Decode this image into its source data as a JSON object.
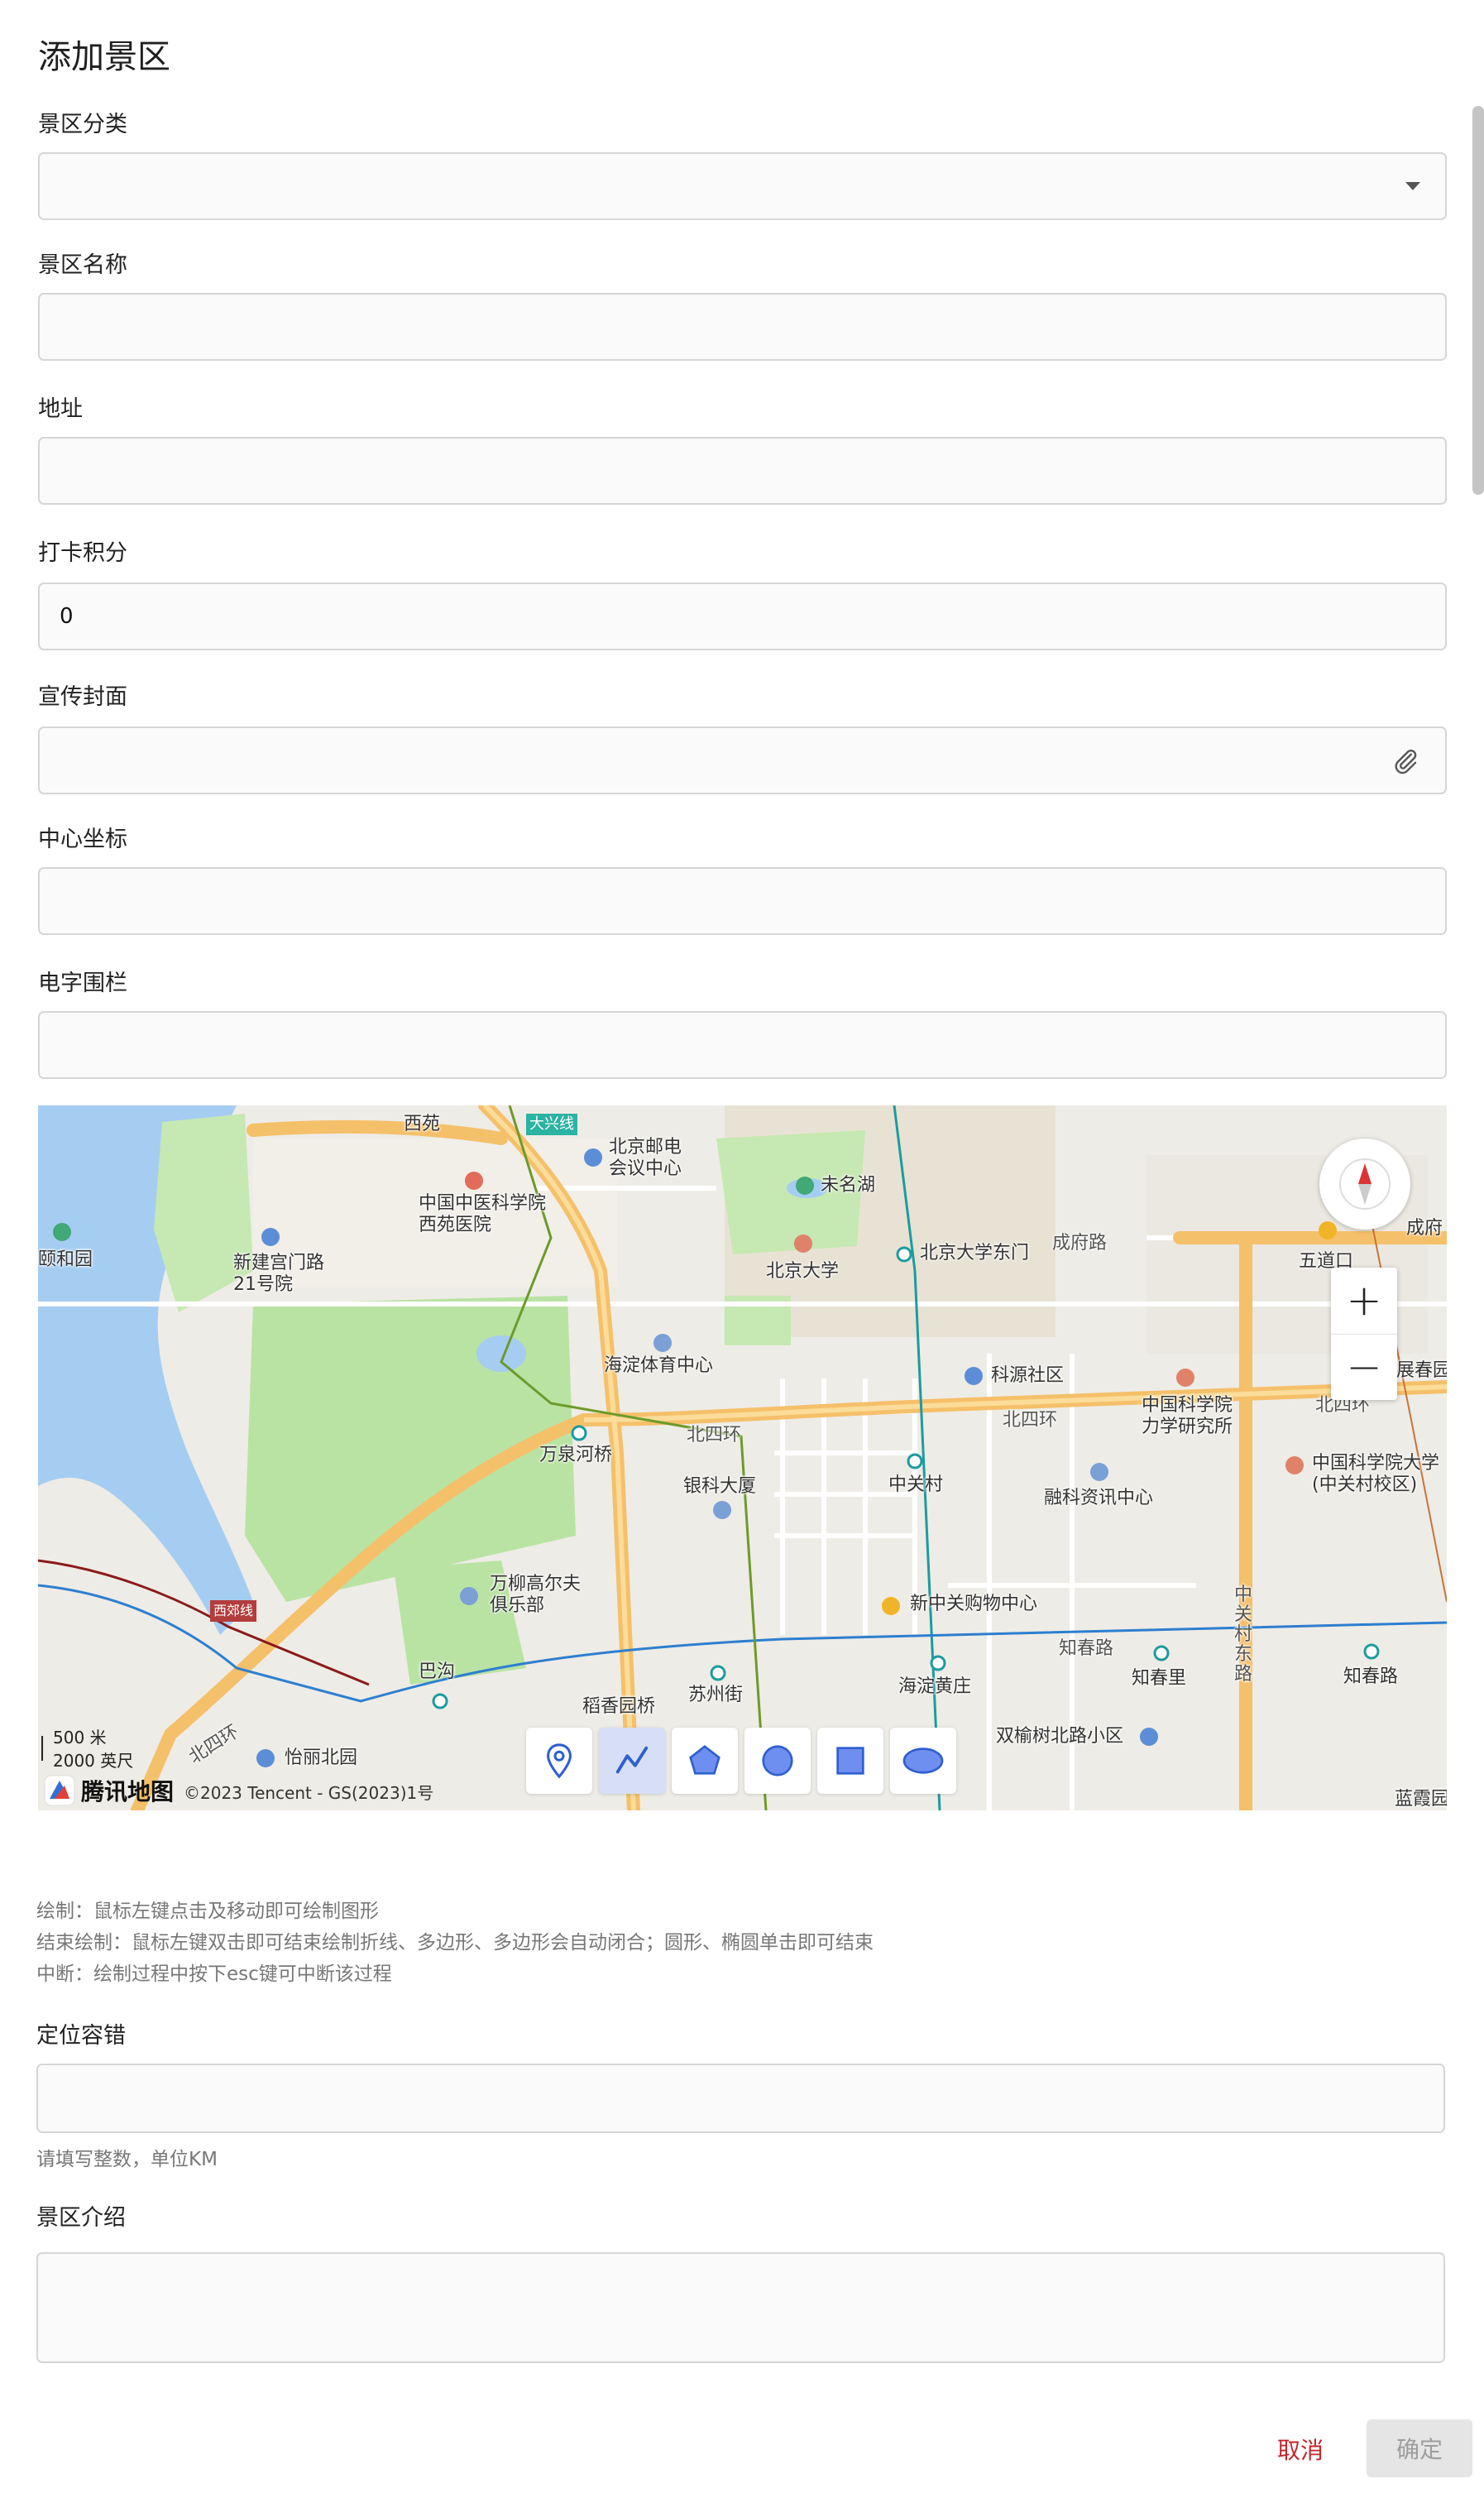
{
  "page": {
    "title": "添加景区"
  },
  "form": {
    "category": {
      "label": "景区分类",
      "value": ""
    },
    "name": {
      "label": "景区名称",
      "value": ""
    },
    "address": {
      "label": "地址",
      "value": ""
    },
    "points": {
      "label": "打卡积分",
      "value": "0"
    },
    "cover": {
      "label": "宣传封面",
      "value": ""
    },
    "center": {
      "label": "中心坐标",
      "value": ""
    },
    "fence": {
      "label": "电字围栏",
      "value": ""
    },
    "tolerance": {
      "label": "定位容错",
      "value": "",
      "hint": "请填写整数，单位KM"
    },
    "intro": {
      "label": "景区介绍",
      "value": ""
    }
  },
  "map": {
    "pois": [
      "西苑",
      "大兴线",
      "北京邮电会议中心",
      "未名湖",
      "中国中医科学院西苑医院",
      "颐和园",
      "新建宫门路21号院",
      "北京大学",
      "北京大学东门",
      "成府路",
      "五道口",
      "成府",
      "海淀体育中心",
      "科源社区",
      "中国科学院力学研究所",
      "展春园",
      "北四环",
      "万泉河桥",
      "银科大厦",
      "中关村",
      "融科资讯中心",
      "中国科学院大学(中关村校区)",
      "万柳高尔夫俱乐部",
      "新中关购物中心",
      "西郊线",
      "巴沟",
      "知春路",
      "知春里",
      "中关村东路",
      "稻香园桥",
      "苏州街",
      "海淀黄庄",
      "双榆树北路小区",
      "怡丽北园",
      "蓝霞园"
    ],
    "scale_metric": "500 米",
    "scale_imperial": "2000 英尺",
    "brand": "腾讯地图",
    "copyright": "©2023 Tencent - GS(2023)1号",
    "zoom_in": "+",
    "zoom_out": "−",
    "tools": [
      "marker-icon",
      "polyline-icon",
      "polygon-icon",
      "circle-icon",
      "rectangle-icon",
      "ellipse-icon"
    ]
  },
  "help": {
    "line1": "绘制：鼠标左键点击及移动即可绘制图形",
    "line2": "结束绘制：鼠标左键双击即可结束绘制折线、多边形、多边形会自动闭合；圆形、椭圆单击即可结束",
    "line3": "中断：绘制过程中按下esc键可中断该过程"
  },
  "actions": {
    "cancel": "取消",
    "ok": "确定"
  },
  "colors": {
    "danger": "#c1262b",
    "water": "#a5cdf2",
    "park": "#b9e3a3",
    "road_major": "#f5c06a"
  }
}
